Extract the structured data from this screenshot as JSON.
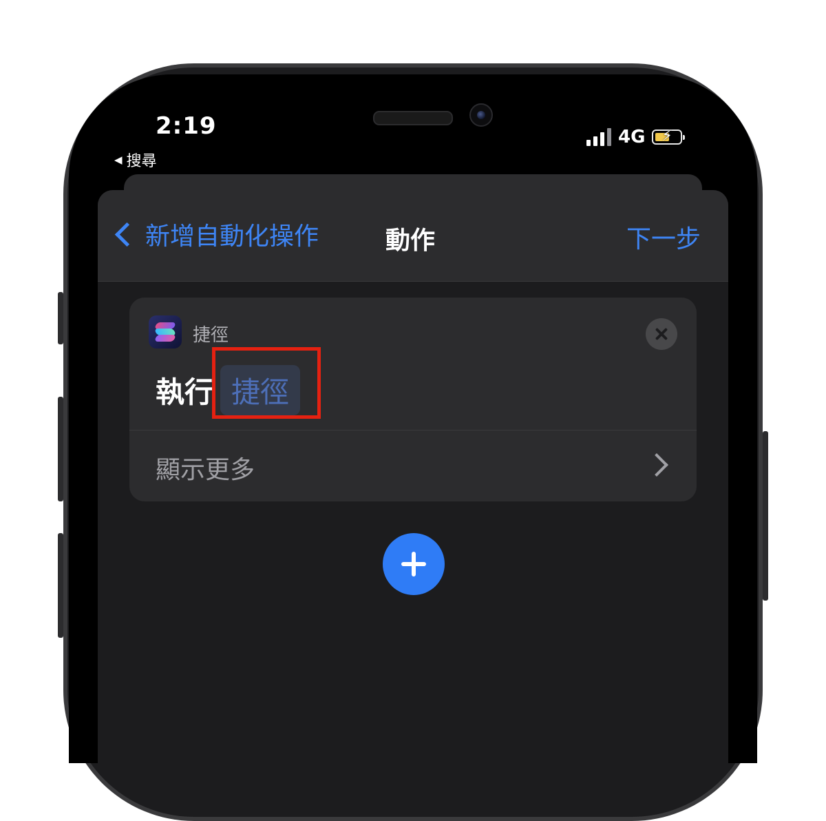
{
  "status_bar": {
    "time": "2:19",
    "back_app": "搜尋",
    "back_arrow": "◀",
    "network": "4G",
    "battery_charging": true,
    "battery_color": "#f2c94c"
  },
  "nav": {
    "back_label": "新增自動化操作",
    "title": "動作",
    "next_label": "下一步"
  },
  "action_card": {
    "app_icon": "shortcuts-app-icon",
    "app_name": "捷徑",
    "run_label": "執行",
    "token_label": "捷徑",
    "highlight_color": "#e52111",
    "show_more_label": "顯示更多"
  },
  "add_button": {
    "icon": "plus-icon",
    "color": "#2f7cf6"
  },
  "colors": {
    "accent": "#3e85f5",
    "background": "#1c1c1e",
    "card": "#2c2c2e"
  }
}
